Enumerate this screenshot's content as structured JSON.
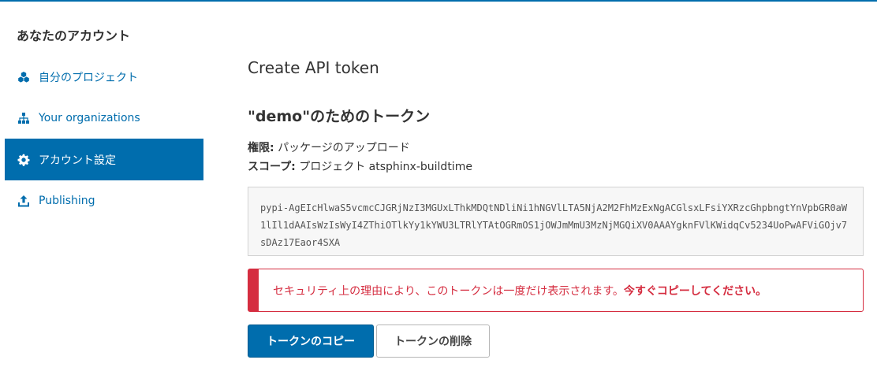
{
  "sidebar": {
    "title": "あなたのアカウント",
    "items": [
      {
        "label": "自分のプロジェクト",
        "icon": "cubes-icon"
      },
      {
        "label": "Your organizations",
        "icon": "sitemap-icon"
      },
      {
        "label": "アカウント設定",
        "icon": "gear-icon"
      },
      {
        "label": "Publishing",
        "icon": "upload-icon"
      }
    ],
    "active_index": 2
  },
  "main": {
    "title": "Create API token",
    "token_heading": "\"demo\"のためのトークン",
    "permissions_label": "権限:",
    "permissions_value": "パッケージのアップロード",
    "scope_label": "スコープ:",
    "scope_value": "プロジェクト atsphinx-buildtime",
    "token": "pypi-AgEIcHlwaS5vcmcCJGRjNzI3MGUxLThkMDQtNDliNi1hNGVlLTA5NjA2M2FhMzExNgACGlsxLFsiYXRzcGhpbngtYnVpbGR0aW1lIl1dAAIsWzIsWyI4ZThiOTlkYy1kYWU3LTRlYTAtOGRmOS1jOWJmMmU3MzNjMGQiXV0AAAYgknFVlKWidqCv5234UoPwAFViGOjv7sDAz17Eaor4SXA",
    "warning_text": "セキュリティ上の理由により、このトークンは一度だけ表示されます。",
    "warning_emphasis": "今すぐコピーしてください。",
    "copy_button": "トークンのコピー",
    "delete_button": "トークンの削除"
  },
  "colors": {
    "accent": "#006dad",
    "danger": "#d52d40"
  }
}
